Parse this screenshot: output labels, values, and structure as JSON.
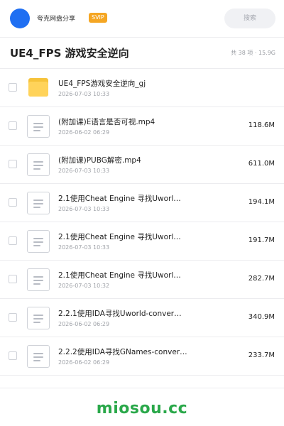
{
  "header": {
    "app_name": "夸克网盘分享",
    "badge": "SVIP",
    "search_placeholder": "搜索"
  },
  "folder": {
    "title": "UE4_FPS 游戏安全逆向",
    "summary": "共 38 项 · 15.9G"
  },
  "files": [
    {
      "type": "folder",
      "name": "UE4_FPS游戏安全逆向_gj",
      "date": "2026-07-03 10:33",
      "size": ""
    },
    {
      "type": "file",
      "name": "(附加课)E语言是否可视.mp4",
      "date": "2026-06-02 06:29",
      "size": "118.6M"
    },
    {
      "type": "file",
      "name": "(附加课)PUBG解密.mp4",
      "date": "2026-07-03 10:33",
      "size": "611.0M"
    },
    {
      "type": "file",
      "name": "2.1使用Cheat Engine 寻找Uworl…",
      "date": "2026-07-03 10:33",
      "size": "194.1M"
    },
    {
      "type": "file",
      "name": "2.1使用Cheat Engine 寻找Uworl…",
      "date": "2026-07-03 10:33",
      "size": "191.7M"
    },
    {
      "type": "file",
      "name": "2.1使用Cheat Engine 寻找Uworl…",
      "date": "2026-07-03 10:32",
      "size": "282.7M"
    },
    {
      "type": "file",
      "name": "2.2.1使用IDA寻找Uworld-conver…",
      "date": "2026-06-02 06:29",
      "size": "340.9M"
    },
    {
      "type": "file",
      "name": "2.2.2使用IDA寻找GNames-conver…",
      "date": "2026-06-02 06:29",
      "size": "233.7M"
    }
  ],
  "watermark": "miosou.cc",
  "colors": {
    "accent": "#1f6ff2",
    "svip": "#f5a623",
    "watermark": "#2aa84a",
    "folder": "#ffd35a"
  },
  "icons": {
    "folder": "folder-icon",
    "file": "document-icon"
  }
}
